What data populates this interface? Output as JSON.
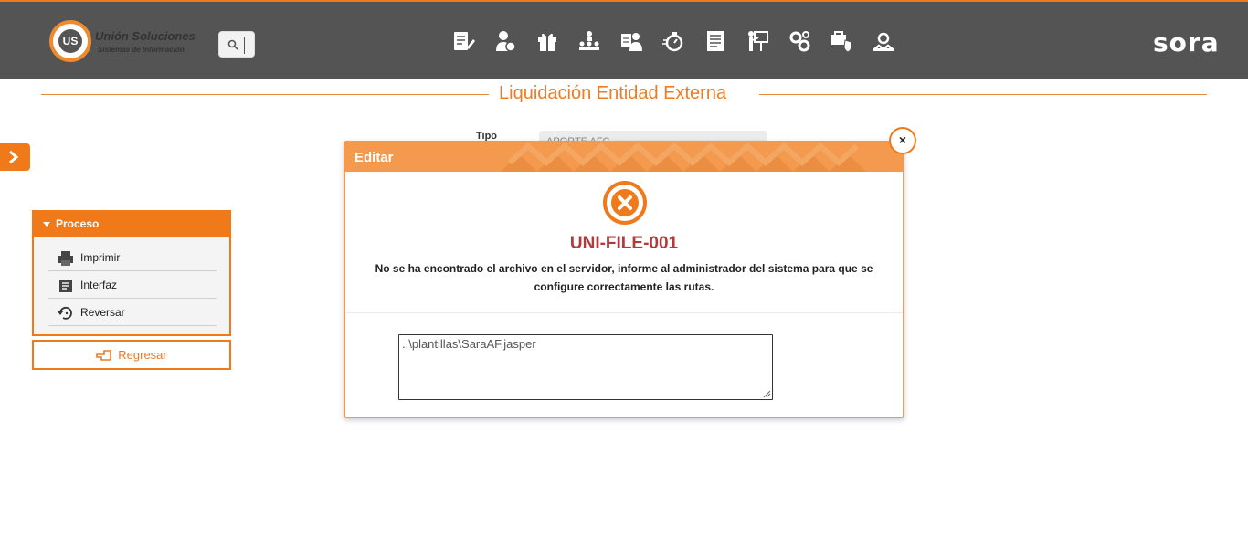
{
  "header": {
    "logo_title": "Unión Soluciones",
    "logo_subtitle": "Sistemas de Información",
    "logo_initials": "US",
    "brand": "sora",
    "nav_icons": [
      "edit-document-icon",
      "user-payment-icon",
      "gift-icon",
      "org-hierarchy-icon",
      "user-id-card-icon",
      "stopwatch-icon",
      "report-document-icon",
      "presentation-icon",
      "gears-icon",
      "secure-cart-icon",
      "support-group-icon"
    ]
  },
  "page": {
    "title": "Liquidación Entidad Externa",
    "form": {
      "tipo_label": "Tipo",
      "tipo_value": "APORTE AFC"
    }
  },
  "sidebar": {
    "panel_title": "Proceso",
    "items": [
      {
        "label": "Imprimir",
        "icon": "printer-icon"
      },
      {
        "label": "Interfaz",
        "icon": "document-list-icon"
      },
      {
        "label": "Reversar",
        "icon": "undo-clock-icon"
      }
    ],
    "back_label": "Regresar"
  },
  "modal": {
    "title": "Editar",
    "close_label": "×",
    "error_code": "UNI-FILE-001",
    "error_message": "No se ha encontrado el archivo en el servidor, informe al administrador del sistema para que se configure correctamente las rutas.",
    "path_value": "..\\plantillas\\SaraAF.jasper"
  },
  "colors": {
    "accent": "#f07a1a",
    "header_bg": "#545454",
    "error": "#b23a3a",
    "modal_header": "#f39a4e"
  }
}
